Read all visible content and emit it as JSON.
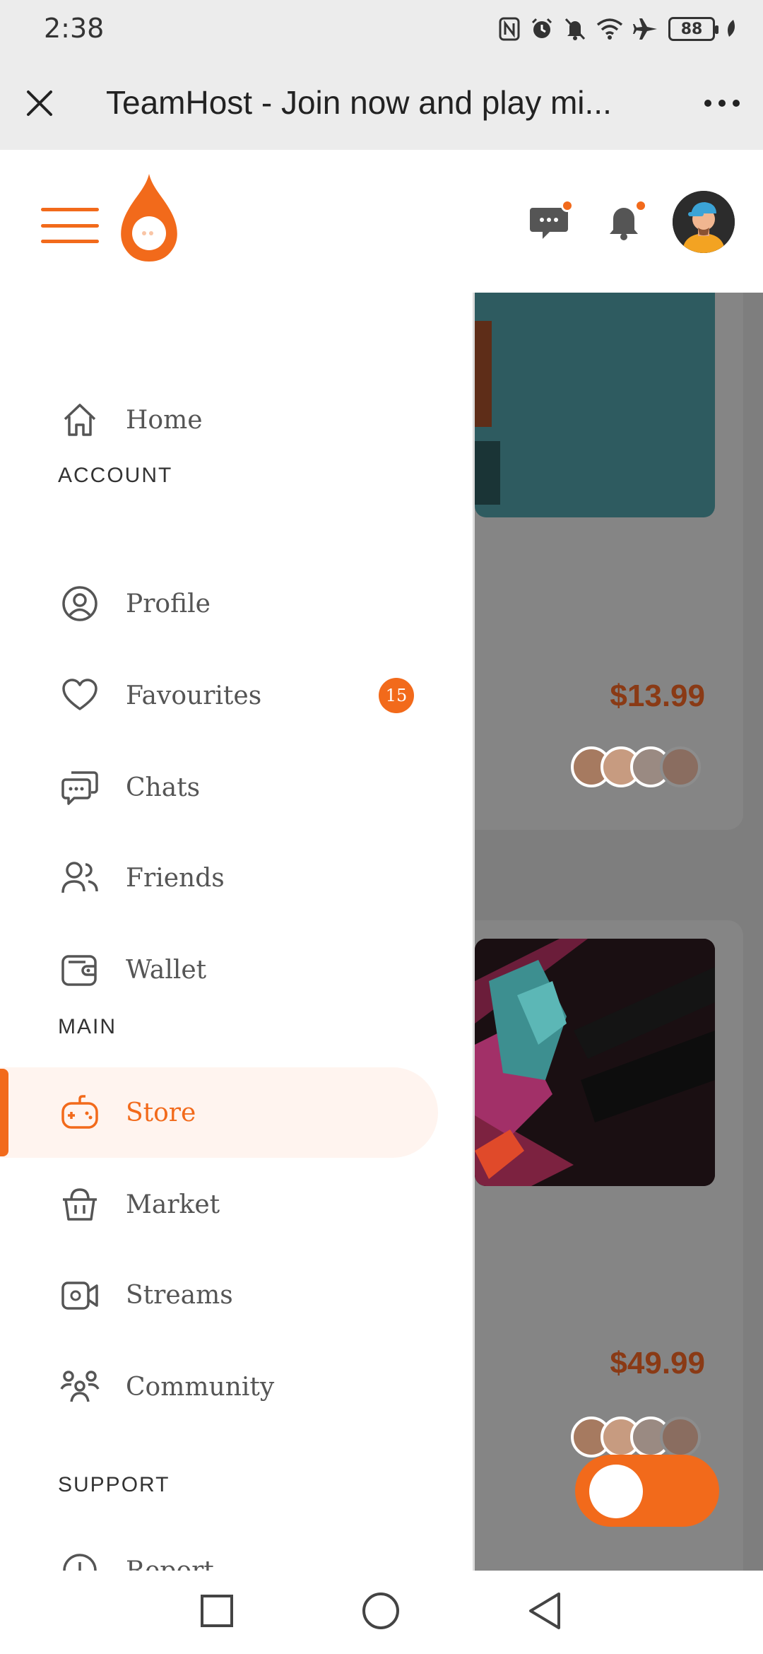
{
  "status_bar": {
    "time": "2:38",
    "battery": "88",
    "icons": [
      "nfc-icon",
      "alarm-icon",
      "mute-bell-icon",
      "wifi-icon",
      "airplane-icon",
      "battery-icon",
      "leaf-icon"
    ]
  },
  "browser": {
    "title": "TeamHost - Join now and play mi..."
  },
  "header": {
    "icons": [
      "menu-icon",
      "flame-logo",
      "chat-icon",
      "bell-icon",
      "avatar"
    ],
    "accent_color": "#f26a1b"
  },
  "drawer": {
    "home": "Home",
    "account_heading": "ACCOUNT",
    "profile": "Profile",
    "favourites": "Favourites",
    "favourites_badge": "15",
    "chats": "Chats",
    "friends": "Friends",
    "wallet": "Wallet",
    "main_heading": "MAIN",
    "store": "Store",
    "market": "Market",
    "streams": "Streams",
    "community": "Community",
    "support_heading": "SUPPORT",
    "report": "Report"
  },
  "background": {
    "price_1": "$13.99",
    "price_2": "$49.99"
  },
  "toggle": {
    "state": "on"
  }
}
